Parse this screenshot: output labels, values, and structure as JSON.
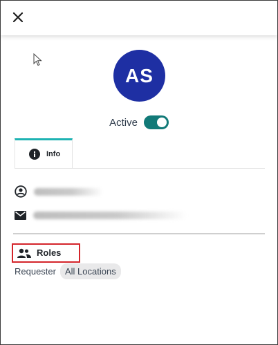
{
  "header": {
    "close_icon": "close-icon"
  },
  "profile": {
    "initials": "AS",
    "avatar_color": "#1e2fa3",
    "status_label": "Active",
    "status_active": true,
    "toggle_color": "#127a78"
  },
  "tabs": [
    {
      "label": "Info",
      "icon": "info-icon",
      "active": true,
      "accent_color": "#1db3b3"
    }
  ],
  "fields": [
    {
      "icon": "account-circle-icon",
      "value": ""
    },
    {
      "icon": "mail-icon",
      "value": ""
    }
  ],
  "roles": {
    "icon": "people-icon",
    "title": "Roles",
    "highlight_color": "#d4242a",
    "role_name": "Requester",
    "location_chip": "All Locations"
  }
}
